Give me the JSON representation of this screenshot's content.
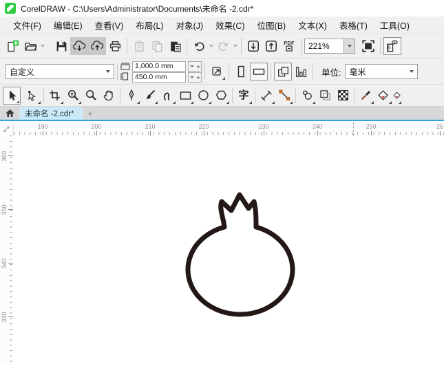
{
  "window": {
    "title": "CorelDRAW - C:\\Users\\Administrator\\Documents\\未命名 -2.cdr*"
  },
  "menu": {
    "items": [
      "文件(F)",
      "编辑(E)",
      "查看(V)",
      "布局(L)",
      "对象(J)",
      "效果(C)",
      "位图(B)",
      "文本(X)",
      "表格(T)",
      "工具(O)"
    ]
  },
  "toolbar": {
    "zoom_value": "221%",
    "pdf_label": "PDF"
  },
  "property_bar": {
    "preset_value": "自定义",
    "page_width": "1,000.0 mm",
    "page_height": "450.0 mm",
    "units_label": "单位:",
    "units_value": "毫米"
  },
  "toolbox": {
    "text_glyph": "字"
  },
  "tabs": {
    "active_label": "未命名 -2.cdr*",
    "new_tab_label": "+"
  },
  "rulers": {
    "h_labels": [
      "190",
      "200",
      "210",
      "220",
      "230",
      "240",
      "250",
      "26"
    ],
    "v_labels": [
      "360",
      "350",
      "340",
      "330"
    ]
  },
  "colors": {
    "accent_blue": "#2ba3df",
    "tab_active_bg": "#cde9f8",
    "new_doc_green": "#2ecc40",
    "connector_orange": "#e87d1e",
    "fill_red": "#d92b2b",
    "drawing_stroke": "#231815",
    "toolbar_bg": "#f0f0f0"
  },
  "drawing": {
    "shape": "pomegranate-outline"
  }
}
